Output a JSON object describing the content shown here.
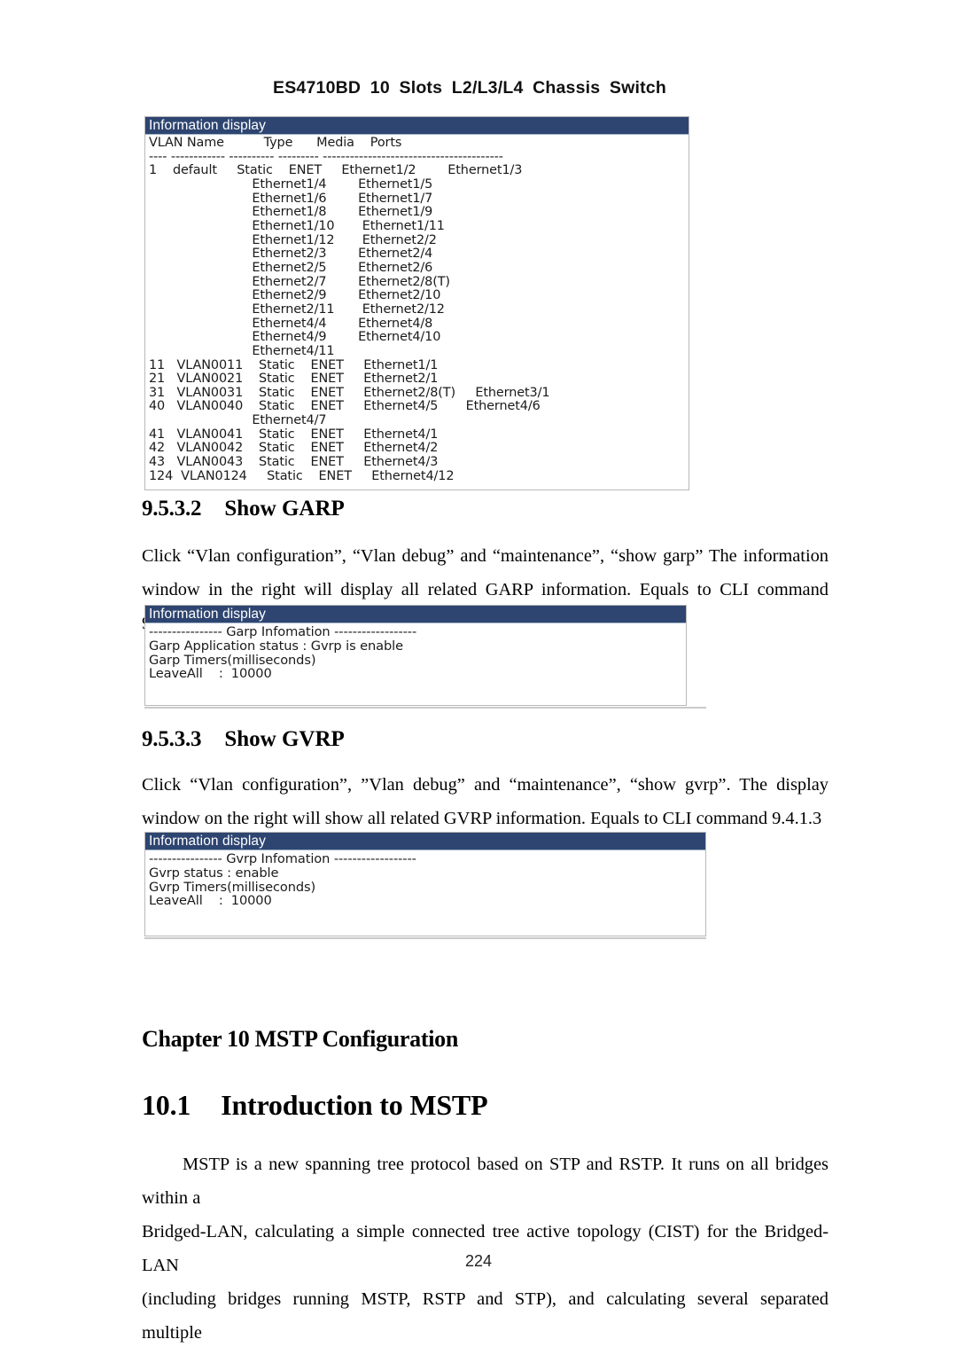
{
  "header": {
    "running_head": "ES4710BD 10 Slots L2/L3/L4 Chassis Switch"
  },
  "vlan_panel": {
    "title": "Information display",
    "console_text": "VLAN Name          Type      Media    Ports\n---- ------------ ---------- --------- ----------------------------------------\n1    default     Static    ENET     Ethernet1/2        Ethernet1/3\n                          Ethernet1/4        Ethernet1/5\n                          Ethernet1/6        Ethernet1/7\n                          Ethernet1/8        Ethernet1/9\n                          Ethernet1/10       Ethernet1/11\n                          Ethernet1/12       Ethernet2/2\n                          Ethernet2/3        Ethernet2/4\n                          Ethernet2/5        Ethernet2/6\n                          Ethernet2/7        Ethernet2/8(T)\n                          Ethernet2/9        Ethernet2/10\n                          Ethernet2/11       Ethernet2/12\n                          Ethernet4/4        Ethernet4/8\n                          Ethernet4/9        Ethernet4/10\n                          Ethernet4/11\n11   VLAN0011    Static    ENET     Ethernet1/1\n21   VLAN0021    Static    ENET     Ethernet2/1\n31   VLAN0031    Static    ENET     Ethernet2/8(T)     Ethernet3/1\n40   VLAN0040    Static    ENET     Ethernet4/5       Ethernet4/6\n                          Ethernet4/7\n41   VLAN0041    Static    ENET     Ethernet4/1\n42   VLAN0042    Static    ENET     Ethernet4/2\n43   VLAN0043    Static    ENET     Ethernet4/3\n124  VLAN0124     Static    ENET     Ethernet4/12",
    "columns": [
      "VLAN",
      "Name",
      "Type",
      "Media",
      "Ports"
    ],
    "rows": [
      {
        "vlan": "1",
        "name": "default",
        "type": "Static",
        "media": "ENET",
        "ports": [
          "Ethernet1/2",
          "Ethernet1/3",
          "Ethernet1/4",
          "Ethernet1/5",
          "Ethernet1/6",
          "Ethernet1/7",
          "Ethernet1/8",
          "Ethernet1/9",
          "Ethernet1/10",
          "Ethernet1/11",
          "Ethernet1/12",
          "Ethernet2/2",
          "Ethernet2/3",
          "Ethernet2/4",
          "Ethernet2/5",
          "Ethernet2/6",
          "Ethernet2/7",
          "Ethernet2/8(T)",
          "Ethernet2/9",
          "Ethernet2/10",
          "Ethernet2/11",
          "Ethernet2/12",
          "Ethernet4/4",
          "Ethernet4/8",
          "Ethernet4/9",
          "Ethernet4/10",
          "Ethernet4/11"
        ]
      },
      {
        "vlan": "11",
        "name": "VLAN0011",
        "type": "Static",
        "media": "ENET",
        "ports": [
          "Ethernet1/1"
        ]
      },
      {
        "vlan": "21",
        "name": "VLAN0021",
        "type": "Static",
        "media": "ENET",
        "ports": [
          "Ethernet2/1"
        ]
      },
      {
        "vlan": "31",
        "name": "VLAN0031",
        "type": "Static",
        "media": "ENET",
        "ports": [
          "Ethernet2/8(T)",
          "Ethernet3/1"
        ]
      },
      {
        "vlan": "40",
        "name": "VLAN0040",
        "type": "Static",
        "media": "ENET",
        "ports": [
          "Ethernet4/5",
          "Ethernet4/6",
          "Ethernet4/7"
        ]
      },
      {
        "vlan": "41",
        "name": "VLAN0041",
        "type": "Static",
        "media": "ENET",
        "ports": [
          "Ethernet4/1"
        ]
      },
      {
        "vlan": "42",
        "name": "VLAN0042",
        "type": "Static",
        "media": "ENET",
        "ports": [
          "Ethernet4/2"
        ]
      },
      {
        "vlan": "43",
        "name": "VLAN0043",
        "type": "Static",
        "media": "ENET",
        "ports": [
          "Ethernet4/3"
        ]
      },
      {
        "vlan": "124",
        "name": "VLAN0124",
        "type": "Static",
        "media": "ENET",
        "ports": [
          "Ethernet4/12"
        ]
      }
    ]
  },
  "section_garp": {
    "number": "9.5.3.2",
    "title": "Show GARP",
    "body": "Click “Vlan configuration”, “Vlan debug” and “maintenance”, “show garp” The information window in the right will display all related GARP information. Equals to CLI command 9.4.1.2"
  },
  "garp_panel": {
    "title": "Information display",
    "console_text": "---------------- Garp Infomation ------------------\nGarp Application status : Gvrp is enable\nGarp Timers(milliseconds)\nLeaveAll    :  10000"
  },
  "section_gvrp": {
    "number": "9.5.3.3",
    "title": "Show GVRP",
    "body": "Click “Vlan configuration”, ”Vlan debug” and “maintenance”, “show gvrp”. The display window on the right will show all related GVRP information. Equals to CLI command 9.4.1.3"
  },
  "gvrp_panel": {
    "title": "Information display",
    "console_text": "---------------- Gvrp Infomation ------------------\nGvrp status : enable\nGvrp Timers(milliseconds)\nLeaveAll    :  10000"
  },
  "chapter": {
    "heading": "Chapter 10 MSTP Configuration"
  },
  "section_intro": {
    "number": "10.1",
    "title": "Introduction to MSTP",
    "line1": "MSTP is a new spanning tree protocol based on STP and RSTP. It runs on all bridges within a",
    "line2": "Bridged-LAN, calculating a simple connected tree active topology (CIST) for the Bridged-LAN",
    "line3": "(including bridges running MSTP, RSTP and STP), and calculating several separated multiple"
  },
  "footer": {
    "page_number": "224"
  },
  "colors": {
    "titlebar_bg": "#2e4571",
    "titlebar_text": "#ffffff",
    "panel_border": "#b9b9b9",
    "text": "#000000"
  }
}
